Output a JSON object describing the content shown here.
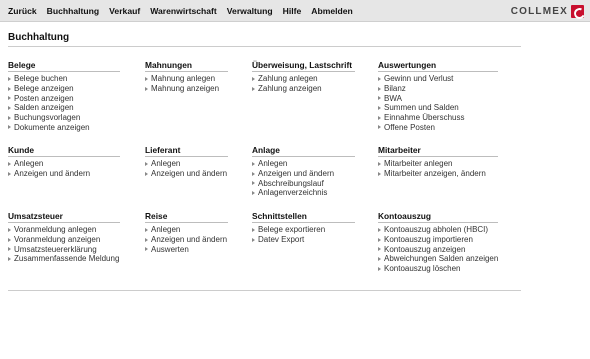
{
  "nav": {
    "items": [
      "Zurück",
      "Buchhaltung",
      "Verkauf",
      "Warenwirtschaft",
      "Verwaltung",
      "Hilfe",
      "Abmelden"
    ]
  },
  "logo": {
    "text": "COLLMEX",
    "icon": "collmex-logo-icon"
  },
  "page": {
    "title": "Buchhaltung"
  },
  "sections": {
    "belege": {
      "title": "Belege",
      "links": [
        "Belege buchen",
        "Belege anzeigen",
        "Posten anzeigen",
        "Salden anzeigen",
        "Buchungsvorlagen",
        "Dokumente anzeigen"
      ]
    },
    "mahnungen": {
      "title": "Mahnungen",
      "links": [
        "Mahnung anlegen",
        "Mahnung anzeigen"
      ]
    },
    "ueberweisung": {
      "title": "Überweisung, Lastschrift",
      "links": [
        "Zahlung anlegen",
        "Zahlung anzeigen"
      ]
    },
    "auswertungen": {
      "title": "Auswertungen",
      "links": [
        "Gewinn und Verlust",
        "Bilanz",
        "BWA",
        "Summen und Salden",
        "Einnahme Überschuss",
        "Offene Posten"
      ]
    },
    "kunde": {
      "title": "Kunde",
      "links": [
        "Anlegen",
        "Anzeigen und ändern"
      ]
    },
    "lieferant": {
      "title": "Lieferant",
      "links": [
        "Anlegen",
        "Anzeigen und ändern"
      ]
    },
    "anlage": {
      "title": "Anlage",
      "links": [
        "Anlegen",
        "Anzeigen und ändern",
        "Abschreibungslauf",
        "Anlagenverzeichnis"
      ]
    },
    "mitarbeiter": {
      "title": "Mitarbeiter",
      "links": [
        "Mitarbeiter anlegen",
        "Mitarbeiter anzeigen, ändern"
      ]
    },
    "umsatzsteuer": {
      "title": "Umsatzsteuer",
      "links": [
        "Voranmeldung anlegen",
        "Voranmeldung anzeigen",
        "Umsatzsteuererklärung",
        "Zusammenfassende Meldung"
      ]
    },
    "reise": {
      "title": "Reise",
      "links": [
        "Anlegen",
        "Anzeigen und ändern",
        "Auswerten"
      ]
    },
    "schnittstellen": {
      "title": "Schnittstellen",
      "links": [
        "Belege exportieren",
        "Datev Export"
      ]
    },
    "kontoauszug": {
      "title": "Kontoauszug",
      "links": [
        "Kontoauszug abholen (HBCI)",
        "Kontoauszug importieren",
        "Kontoauszug anzeigen",
        "Abweichungen Salden anzeigen",
        "Kontoauszug löschen"
      ]
    }
  }
}
